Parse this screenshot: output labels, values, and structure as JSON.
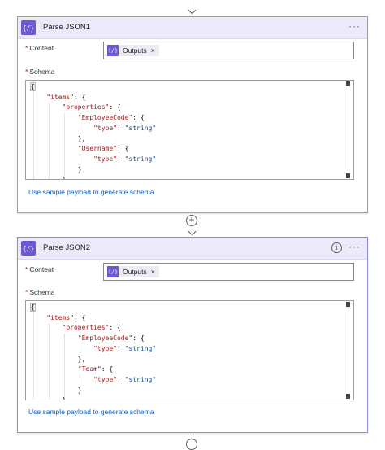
{
  "actions": [
    {
      "title": "Parse JSON1",
      "icon": "parse-json-icon",
      "content_label": "Content",
      "content_token": "Outputs",
      "schema_label": "Schema",
      "schema_lines": [
        "{",
        "    \"items\": {",
        "        \"properties\": {",
        "            \"EmployeeCode\": {",
        "                \"type\": \"string\"",
        "            },",
        "            \"Username\": {",
        "                \"type\": \"string\"",
        "            }",
        "        },"
      ],
      "sample_link": "Use sample payload to generate schema"
    },
    {
      "title": "Parse JSON2",
      "icon": "parse-json-icon",
      "content_label": "Content",
      "content_token": "Outputs",
      "schema_label": "Schema",
      "schema_lines": [
        "{",
        "    \"items\": {",
        "        \"properties\": {",
        "            \"EmployeeCode\": {",
        "                \"type\": \"string\"",
        "            },",
        "            \"Team\": {",
        "                \"type\": \"string\"",
        "            }",
        "        },"
      ],
      "sample_link": "Use sample payload to generate schema"
    }
  ],
  "glyphs": {
    "action_icon": "{/}",
    "token_close": "×",
    "more": "···",
    "info": "i",
    "add_step": "+",
    "required": "*"
  },
  "colors": {
    "header_bg": "#ece9fb",
    "icon_bg": "#6e58d4",
    "link": "#0f5fc2",
    "json_key": "#a31515",
    "json_string": "#0451a5"
  }
}
